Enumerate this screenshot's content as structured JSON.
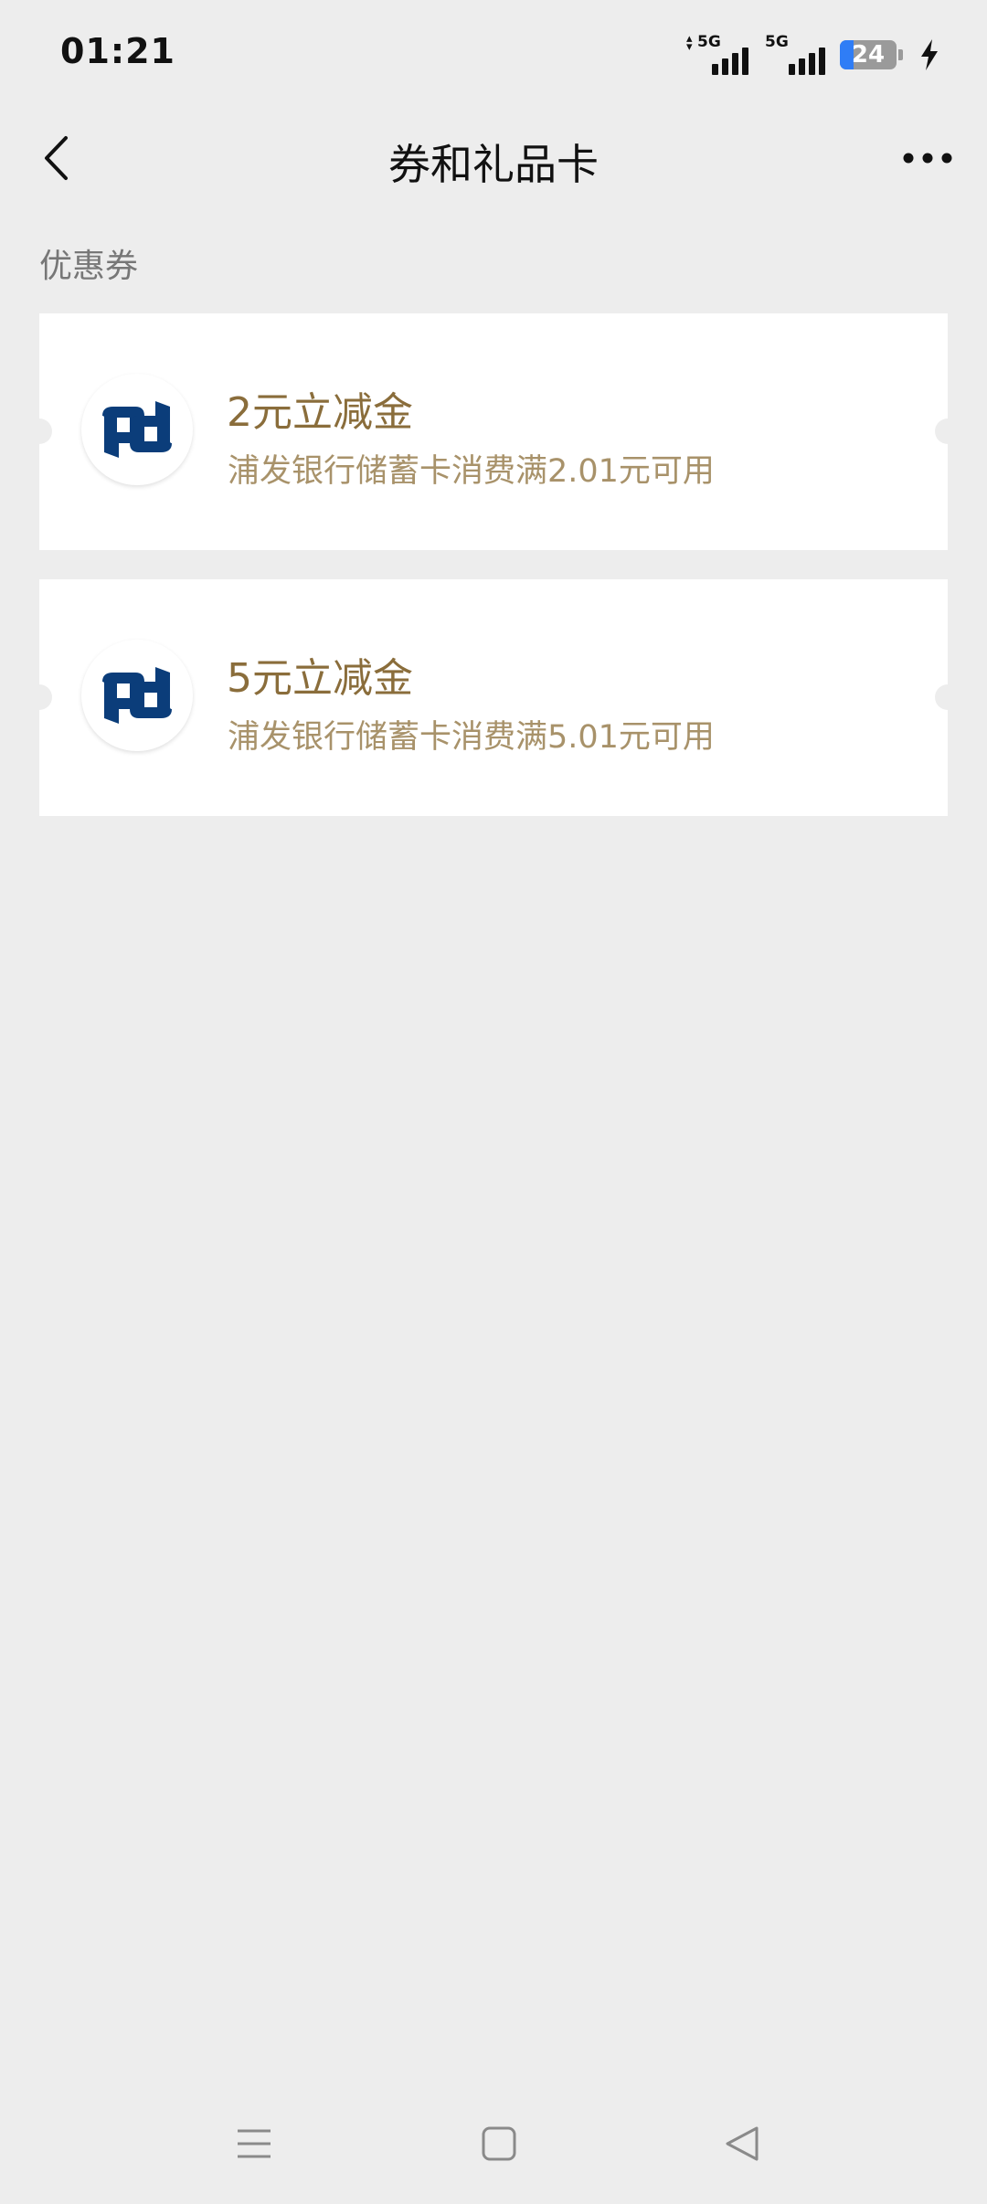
{
  "status_bar": {
    "time": "01:21",
    "signal_1_label": "5G",
    "signal_2_label": "5G",
    "battery_level": "24",
    "battery_fraction": 0.24,
    "icons": [
      "data-arrows-icon",
      "signal-icon",
      "signal-icon",
      "battery-icon",
      "charging-icon"
    ]
  },
  "nav": {
    "title": "券和礼品卡",
    "back_icon": "chevron-left-icon",
    "more_icon": "more-dots-icon"
  },
  "section": {
    "label": "优惠券"
  },
  "coupons": [
    {
      "title": "2元立减金",
      "description": "浦发银行储蓄卡消费满2.01元可用",
      "logo": "spd-bank-logo"
    },
    {
      "title": "5元立减金",
      "description": "浦发银行储蓄卡消费满5.01元可用",
      "logo": "spd-bank-logo"
    }
  ],
  "system_nav": {
    "icons": [
      "menu-icon",
      "home-icon",
      "back-icon"
    ]
  },
  "colors": {
    "background": "#ededed",
    "card": "#ffffff",
    "coupon_title": "#8a6d3b",
    "coupon_desc": "#a8926a",
    "logo_blue": "#0b3d7a",
    "battery_fill": "#2f7df6"
  }
}
